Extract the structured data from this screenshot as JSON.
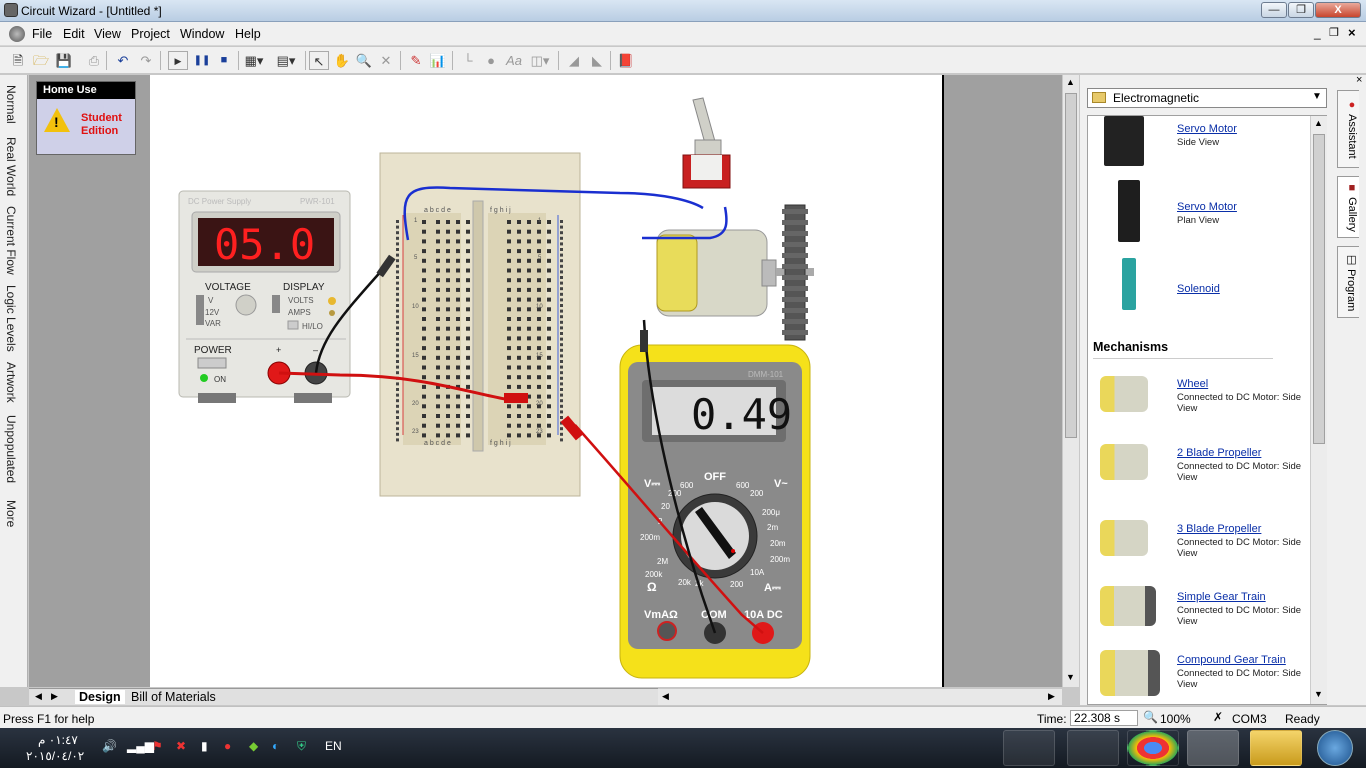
{
  "window": {
    "title": "Circuit Wizard - [Untitled *]",
    "controls": {
      "minimize": "—",
      "restore": "❐",
      "close": "X"
    }
  },
  "menubar": {
    "items": [
      "File",
      "Edit",
      "View",
      "Project",
      "Window",
      "Help"
    ]
  },
  "toolbar": {
    "icons": [
      "new-icon",
      "open-icon",
      "save-icon",
      "print-icon",
      "undo-icon",
      "redo-icon",
      "play-icon",
      "pause-icon",
      "stop-icon",
      "component-icon",
      "board-icon",
      "select-icon",
      "pan-icon",
      "zoom-icon",
      "delete-icon",
      "probe-icon",
      "graph-icon",
      "wire-icon",
      "node-icon",
      "text-icon",
      "align-icon",
      "flip-icon",
      "rotate-icon",
      "book-icon"
    ]
  },
  "left_tabs": [
    "Normal",
    "Real World",
    "Current Flow",
    "Logic Levels",
    "Artwork",
    "Unpopulated",
    "More"
  ],
  "home_use": {
    "header": "Home Use",
    "line1": "Student",
    "line2": "Edition"
  },
  "power_supply": {
    "title": "DC Power Supply",
    "model": "PWR-101",
    "display": "05.0",
    "voltage_label": "VOLTAGE",
    "display_label": "DISPLAY",
    "v_label": "V",
    "twelve_v": "12V",
    "var": "VAR",
    "volts": "VOLTS",
    "amps": "AMPS",
    "hilo": "HI/LO",
    "power_label": "POWER",
    "on_label": "ON",
    "plus": "+",
    "minus": "–"
  },
  "breadboard": {
    "columns_left": "a b c d e",
    "columns_right": "f g h i j",
    "row_numbers": [
      "1",
      "5",
      "10",
      "15",
      "20",
      "23"
    ]
  },
  "multimeter": {
    "model": "DMM-101",
    "reading": "0.49",
    "off": "OFF",
    "vdc": "V⎓",
    "vac": "V~",
    "ohm": "Ω",
    "adc": "A⎓",
    "dial_left": [
      "600",
      "200",
      "20",
      "2",
      "200m",
      "2M",
      "200k",
      "20k",
      "2k"
    ],
    "dial_right": [
      "600",
      "200",
      "200μ",
      "2m",
      "20m",
      "200m",
      "10A",
      "200"
    ],
    "port_vma": "VmАΩ",
    "port_com": "COM",
    "port_10a": "10A DC"
  },
  "sheet_tabs": {
    "design": "Design",
    "bom": "Bill of Materials"
  },
  "right_panel": {
    "category": "Electromagnetic",
    "items": [
      {
        "name": "Servo Motor",
        "sub": "Side View"
      },
      {
        "name": "Servo Motor",
        "sub": "Plan View"
      },
      {
        "name": "Solenoid",
        "sub": ""
      }
    ],
    "section": "Mechanisms",
    "mechanisms": [
      {
        "name": "Wheel",
        "sub": "Connected to DC Motor: Side View"
      },
      {
        "name": "2 Blade Propeller",
        "sub": "Connected to DC Motor: Side View"
      },
      {
        "name": "3 Blade Propeller",
        "sub": "Connected to DC Motor: Side View"
      },
      {
        "name": "Simple Gear Train",
        "sub": "Connected to DC Motor: Side View"
      },
      {
        "name": "Compound Gear Train",
        "sub": "Connected to DC Motor: Side View"
      }
    ],
    "tabs": [
      "Assistant",
      "Gallery",
      "Program"
    ]
  },
  "statusbar": {
    "help": "Press F1 for help",
    "time_label": "Time:",
    "time_value": "22.308 s",
    "zoom": "100%",
    "port": "COM3",
    "state": "Ready"
  },
  "taskbar": {
    "time": "٠١:٤٧ م",
    "date": "٢٠١٥/٠٤/٠٢",
    "lang": "EN"
  },
  "colors": {
    "red_led": "#d4161b",
    "multimeter_body": "#f5e11a",
    "link": "#0a2fa8"
  }
}
